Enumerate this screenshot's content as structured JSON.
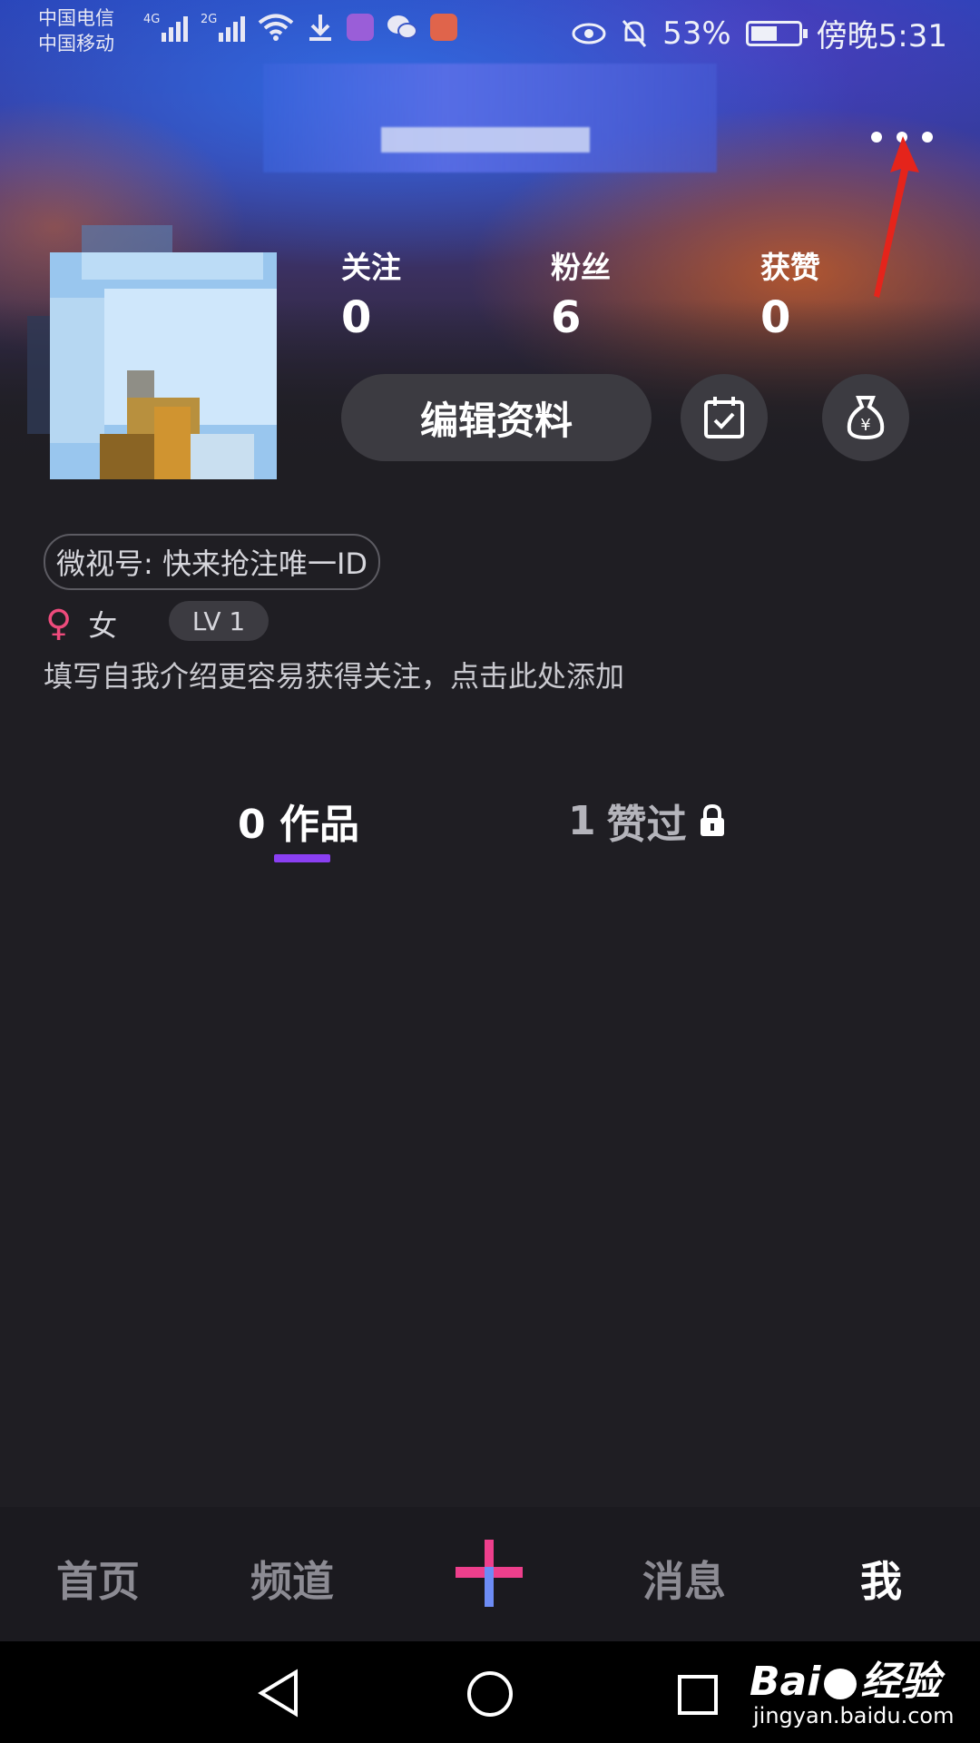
{
  "status_bar": {
    "carrier_1": "中国电信",
    "carrier_2": "中国移动",
    "signal_1_tag": "4G",
    "signal_2_tag": "2G",
    "battery_percent": "53%",
    "time": "傍晚5:31"
  },
  "profile": {
    "stats": [
      {
        "label": "关注",
        "value": "0"
      },
      {
        "label": "粉丝",
        "value": "6"
      },
      {
        "label": "获赞",
        "value": "0"
      }
    ],
    "edit_button_label": "编辑资料",
    "weishi_id": "微视号: 快来抢注唯一ID",
    "gender_symbol": "♀",
    "gender": "女",
    "level": "LV 1",
    "bio_placeholder": "填写自我介绍更容易获得关注，点击此处添加"
  },
  "tabs": [
    {
      "count": "0",
      "label": "作品"
    },
    {
      "count": "1",
      "label": "赞过"
    }
  ],
  "bottom_nav": {
    "items": [
      "首页",
      "频道",
      "消息",
      "我"
    ],
    "active": "我"
  },
  "watermark": {
    "brand": "Bai",
    "brand_cn": "经验",
    "url": "jingyan.baidu.com"
  },
  "colors": {
    "background": "#1f1e23",
    "tab_underline": "#8a3ff2",
    "plus_pink": "#ee3f8c",
    "plus_blue": "#6d8cf5",
    "gender_icon": "#ee4b7c"
  }
}
